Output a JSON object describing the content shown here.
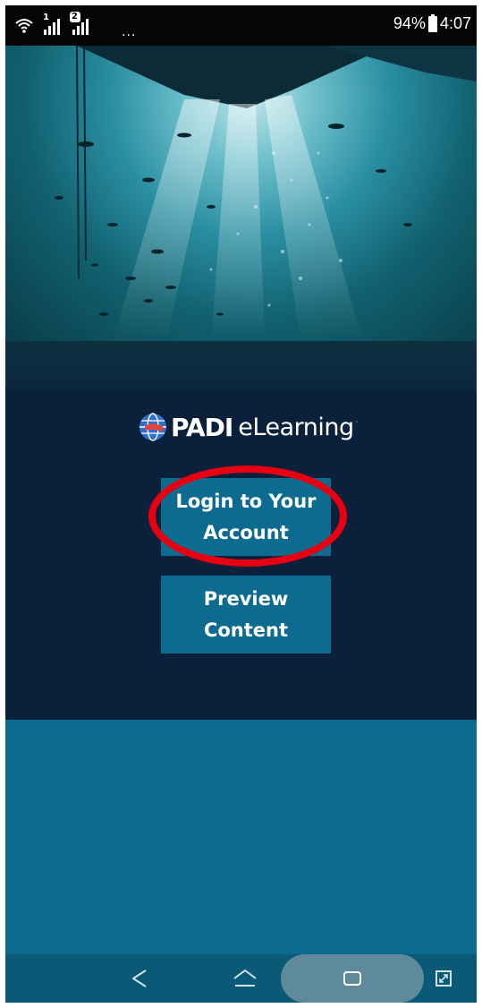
{
  "status_bar": {
    "battery_percent": "94%",
    "time": "4:07",
    "sim1_badge": "1",
    "sim2_badge": "2",
    "overflow": "...",
    "icons": [
      "wifi-icon",
      "signal-sim1-icon",
      "signal-sim2-icon",
      "battery-icon"
    ]
  },
  "hero": {
    "icon": "underwater-scene-image"
  },
  "logo": {
    "brand": "PADI",
    "product": "eLearning",
    "mark": "globe-logo-icon"
  },
  "buttons": {
    "login_label": "Login to Your Account",
    "preview_label": "Preview Content"
  },
  "annotation": {
    "shape": "ellipse",
    "color": "#e60012",
    "target": "login-button"
  },
  "nav_bar": {
    "icons": [
      "back-icon",
      "home-icon",
      "recents-icon",
      "expand-icon"
    ]
  },
  "colors": {
    "panel": "#0b203b",
    "button": "#0c6b8e",
    "lower": "#0b6a8e",
    "nav": "#0a5a77"
  }
}
